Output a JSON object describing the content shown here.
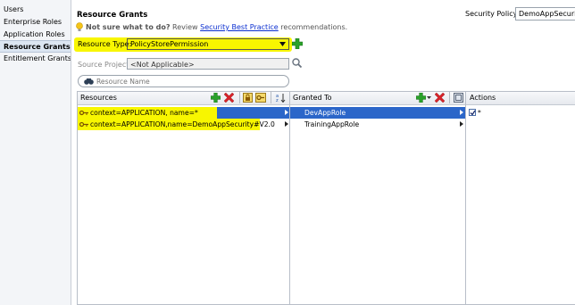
{
  "nav": {
    "items": [
      {
        "label": "Users",
        "active": false
      },
      {
        "label": "Enterprise Roles",
        "active": false
      },
      {
        "label": "Application Roles",
        "active": false
      },
      {
        "label": "Resource Grants",
        "active": true
      },
      {
        "label": "Entitlement Grants",
        "active": false
      }
    ]
  },
  "header": {
    "title": "Resource Grants",
    "hint_prefix": "Not sure what to do?",
    "hint_review": "Review",
    "hint_link": "Security Best Practice",
    "hint_suffix": "recommendations.",
    "policy_label": "Security Policy:",
    "policy_value": "DemoAppSecurity"
  },
  "form": {
    "resource_type_label": "Resource Type:",
    "resource_type_value": "PolicyStorePermission",
    "source_project_label": "Source Project:",
    "source_project_value": "<Not Applicable>",
    "search_placeholder": "Resource Name"
  },
  "resources": {
    "header": "Resources",
    "rows": [
      {
        "text": "context=APPLICATION, name=*",
        "selected": true
      },
      {
        "text": "context=APPLICATION,name=DemoAppSecurity#V2.0",
        "selected": false
      }
    ]
  },
  "granted": {
    "header": "Granted To",
    "rows": [
      {
        "text": "DevAppRole",
        "selected": true
      },
      {
        "text": "TrainingAppRole",
        "selected": false
      }
    ]
  },
  "actions": {
    "header": "Actions",
    "rows": [
      {
        "text": "*",
        "checked": true
      }
    ]
  },
  "colors": {
    "highlight": "#f8f600",
    "selection": "#2b66c9",
    "add_green": "#2aa12a",
    "delete_red": "#d8232a",
    "link_blue": "#0b2fd0"
  }
}
